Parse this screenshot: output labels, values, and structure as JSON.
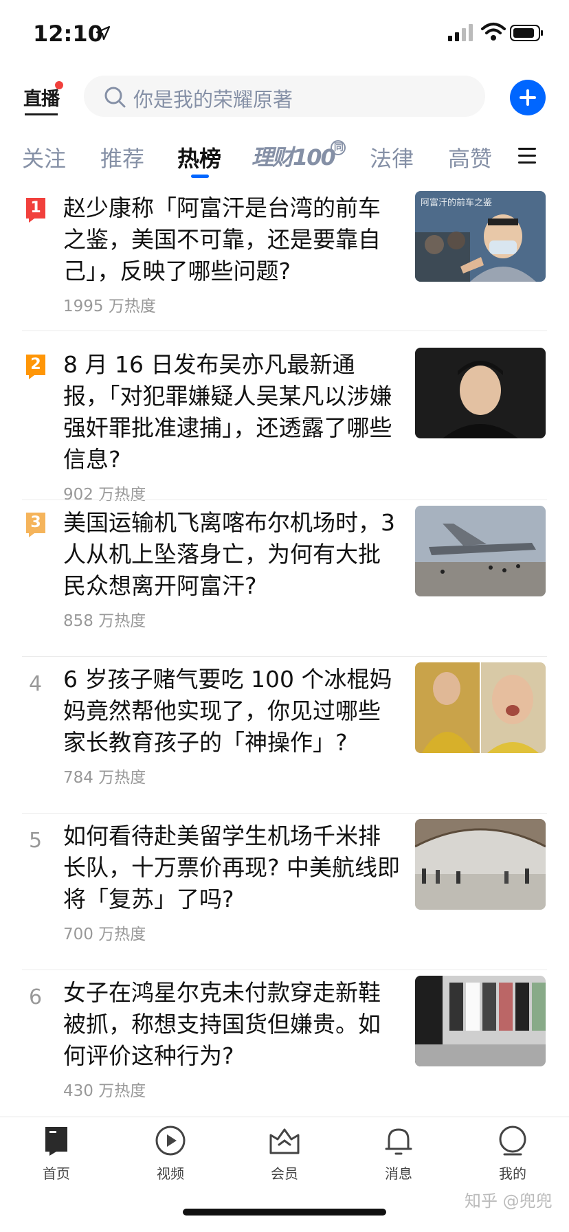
{
  "status_bar": {
    "time": "12:10"
  },
  "top_bar": {
    "live_label": "直播",
    "search_placeholder": "你是我的荣耀原著"
  },
  "tabs": [
    {
      "label": "关注"
    },
    {
      "label": "推荐"
    },
    {
      "label": "热榜"
    },
    {
      "label": "理财100",
      "badge": "同"
    },
    {
      "label": "法律"
    },
    {
      "label": "高赞"
    }
  ],
  "active_tab": "热榜",
  "hot_list": [
    {
      "rank": "1",
      "title": "赵少康称「阿富汗是台湾的前车之鉴，美国不可靠，还是要靠自己」，反映了哪些问题?",
      "heat": "1995 万热度",
      "thumb_caption": "阿富汗的前车之鉴"
    },
    {
      "rank": "2",
      "title": "8 月 16 日发布吴亦凡最新通报，「对犯罪嫌疑人吴某凡以涉嫌强奸罪批准逮捕」，还透露了哪些信息?",
      "heat": "902 万热度"
    },
    {
      "rank": "3",
      "title": "美国运输机飞离喀布尔机场时，3 人从机上坠落身亡，为何有大批民众想离开阿富汗?",
      "heat": "858 万热度"
    },
    {
      "rank": "4",
      "title": "6 岁孩子赌气要吃 100 个冰棍妈妈竟然帮他实现了，你见过哪些家长教育孩子的「神操作」?",
      "heat": "784 万热度"
    },
    {
      "rank": "5",
      "title": "如何看待赴美留学生机场千米排长队，十万票价再现? 中美航线即将「复苏」了吗?",
      "heat": "700 万热度"
    },
    {
      "rank": "6",
      "title": "女子在鸿星尔克未付款穿走新鞋被抓，称想支持国货但嫌贵。如何评价这种行为?",
      "heat": "430 万热度"
    }
  ],
  "rank_colors": {
    "1": "#f1403c",
    "2": "#ff9607",
    "3": "#f5b45b"
  },
  "bottom_nav": [
    {
      "label": "首页",
      "icon": "home-icon"
    },
    {
      "label": "视频",
      "icon": "video-icon"
    },
    {
      "label": "会员",
      "icon": "crown-icon"
    },
    {
      "label": "消息",
      "icon": "bell-icon"
    },
    {
      "label": "我的",
      "icon": "profile-icon"
    }
  ],
  "watermark": "知乎 @兜兜"
}
